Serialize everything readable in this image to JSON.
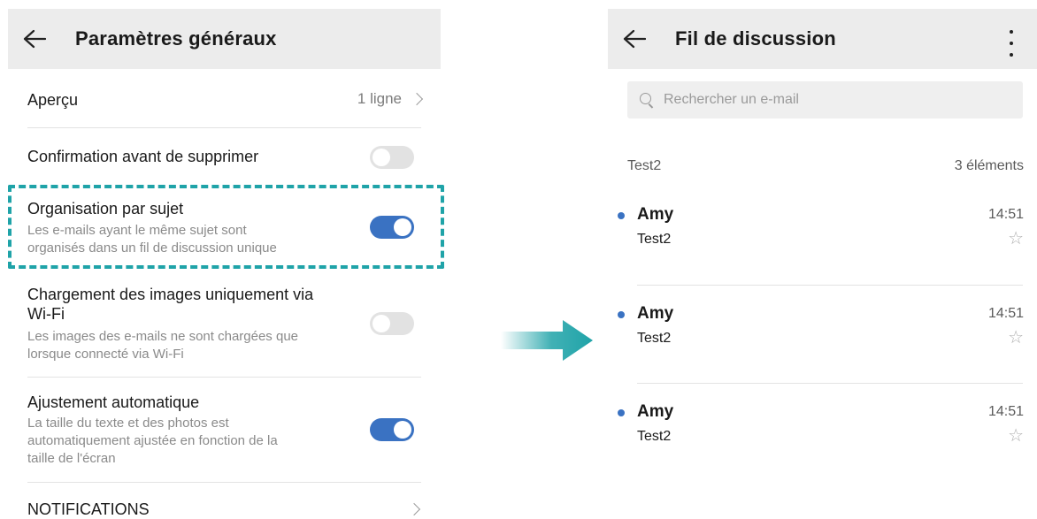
{
  "left": {
    "header": {
      "title": "Paramètres généraux"
    },
    "rows": [
      {
        "title": "Aperçu",
        "value": "1 ligne"
      },
      {
        "title": "Confirmation avant de supprimer",
        "toggle": "off"
      },
      {
        "title": "Organisation par sujet",
        "sub1": "Les e-mails ayant le même sujet sont",
        "sub2": "organisés dans un fil de discussion unique",
        "toggle": "on"
      },
      {
        "title1": "Chargement des images uniquement via",
        "title2": "Wi-Fi",
        "sub1": "Les images des e-mails ne sont chargées que",
        "sub2": "lorsque connecté via Wi-Fi",
        "toggle": "off"
      },
      {
        "title": "Ajustement automatique",
        "sub1": "La taille du texte et des photos est",
        "sub2": "automatiquement ajustée en fonction de la",
        "sub3": "taille de l'écran",
        "toggle": "on"
      },
      {
        "title": "NOTIFICATIONS"
      }
    ]
  },
  "right": {
    "header": {
      "title": "Fil de discussion"
    },
    "search": {
      "placeholder": "Rechercher un e-mail"
    },
    "folder": {
      "name": "Test2",
      "count": "3 éléments"
    },
    "mails": [
      {
        "sender": "Amy",
        "time": "14:51",
        "subject": "Test2"
      },
      {
        "sender": "Amy",
        "time": "14:51",
        "subject": "Test2"
      },
      {
        "sender": "Amy",
        "time": "14:51",
        "subject": "Test2"
      }
    ]
  },
  "colors": {
    "accent": "#3a72c2",
    "highlight": "#1fa3a8",
    "header_bg": "#ececec"
  },
  "icons": {
    "back": "arrow-left-icon",
    "more": "more-vertical-icon",
    "search": "search-icon",
    "star": "star-outline-icon",
    "chevron": "chevron-right-icon",
    "transition": "arrow-right-icon"
  }
}
